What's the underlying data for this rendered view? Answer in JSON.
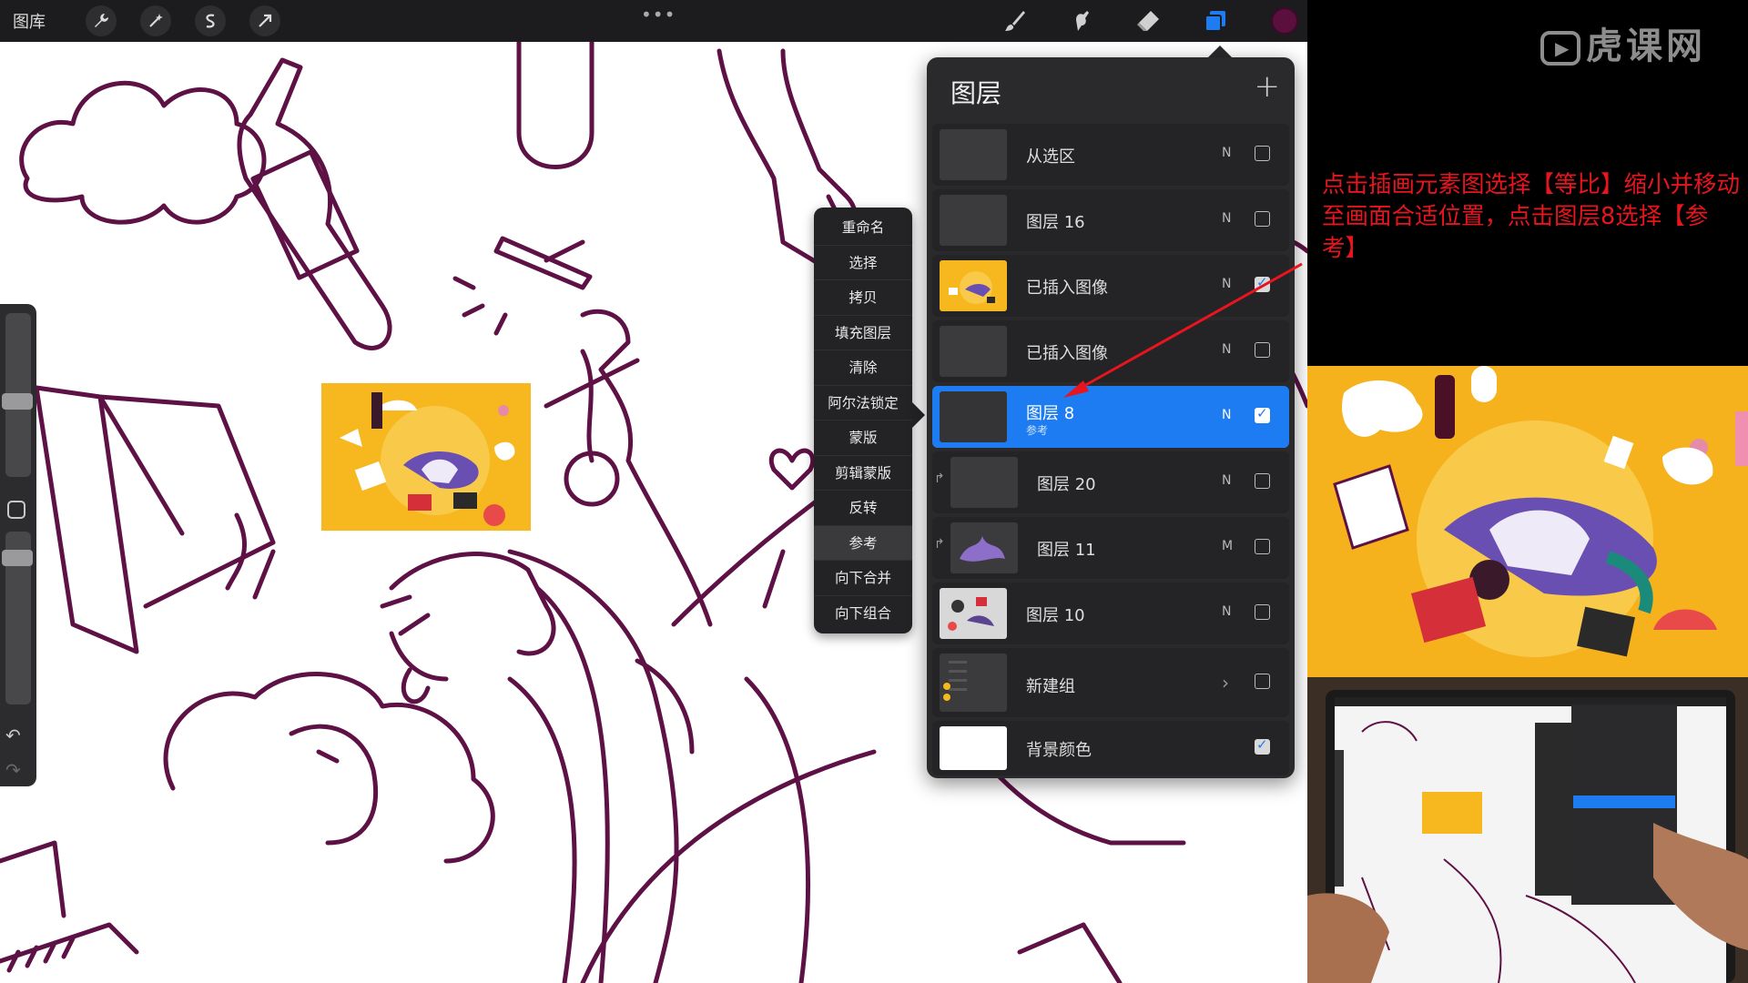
{
  "topbar": {
    "gallery_label": "图库",
    "more_label": "•••",
    "accent_color": "#1d7cf2",
    "current_color": "#5a0f3c",
    "left_tools": [
      "wrench-icon",
      "magic-wand-icon",
      "selection-icon",
      "transform-icon"
    ],
    "right_tools": [
      "brush-icon",
      "smudge-icon",
      "eraser-icon",
      "layers-icon"
    ]
  },
  "sidebar": {
    "modify_icon": "square-icon",
    "undo_icon": "undo-icon",
    "redo_icon": "redo-icon"
  },
  "context_menu": {
    "items": [
      "重命名",
      "选择",
      "拷贝",
      "填充图层",
      "清除",
      "阿尔法锁定",
      "蒙版",
      "剪辑蒙版",
      "反转",
      "参考",
      "向下合并",
      "向下组合"
    ],
    "active_item": "参考"
  },
  "layers_panel": {
    "title": "图层",
    "add_icon": "plus-icon",
    "layers": [
      {
        "name": "从选区",
        "blend": "N",
        "visible": false
      },
      {
        "name": "图层 16",
        "blend": "N",
        "visible": false
      },
      {
        "name": "已插入图像",
        "blend": "N",
        "visible": true
      },
      {
        "name": "已插入图像",
        "blend": "N",
        "visible": false
      },
      {
        "name": "图层 8",
        "subtitle": "参考",
        "blend": "N",
        "visible": true,
        "selected": true
      },
      {
        "name": "图层 20",
        "blend": "N",
        "visible": false
      },
      {
        "name": "图层 11",
        "blend": "M",
        "visible": false
      },
      {
        "name": "图层 10",
        "blend": "N",
        "visible": false
      },
      {
        "name": "新建组",
        "blend": "",
        "visible": false
      },
      {
        "name": "背景颜色",
        "blend": "",
        "visible": true
      }
    ]
  },
  "tutorial": {
    "brand": "虎课网",
    "instruction": "点击插画元素图选择【等比】缩小并移动至画面合适位置，点击图层8选择【参考】",
    "annotation_color": "#e8141e"
  }
}
